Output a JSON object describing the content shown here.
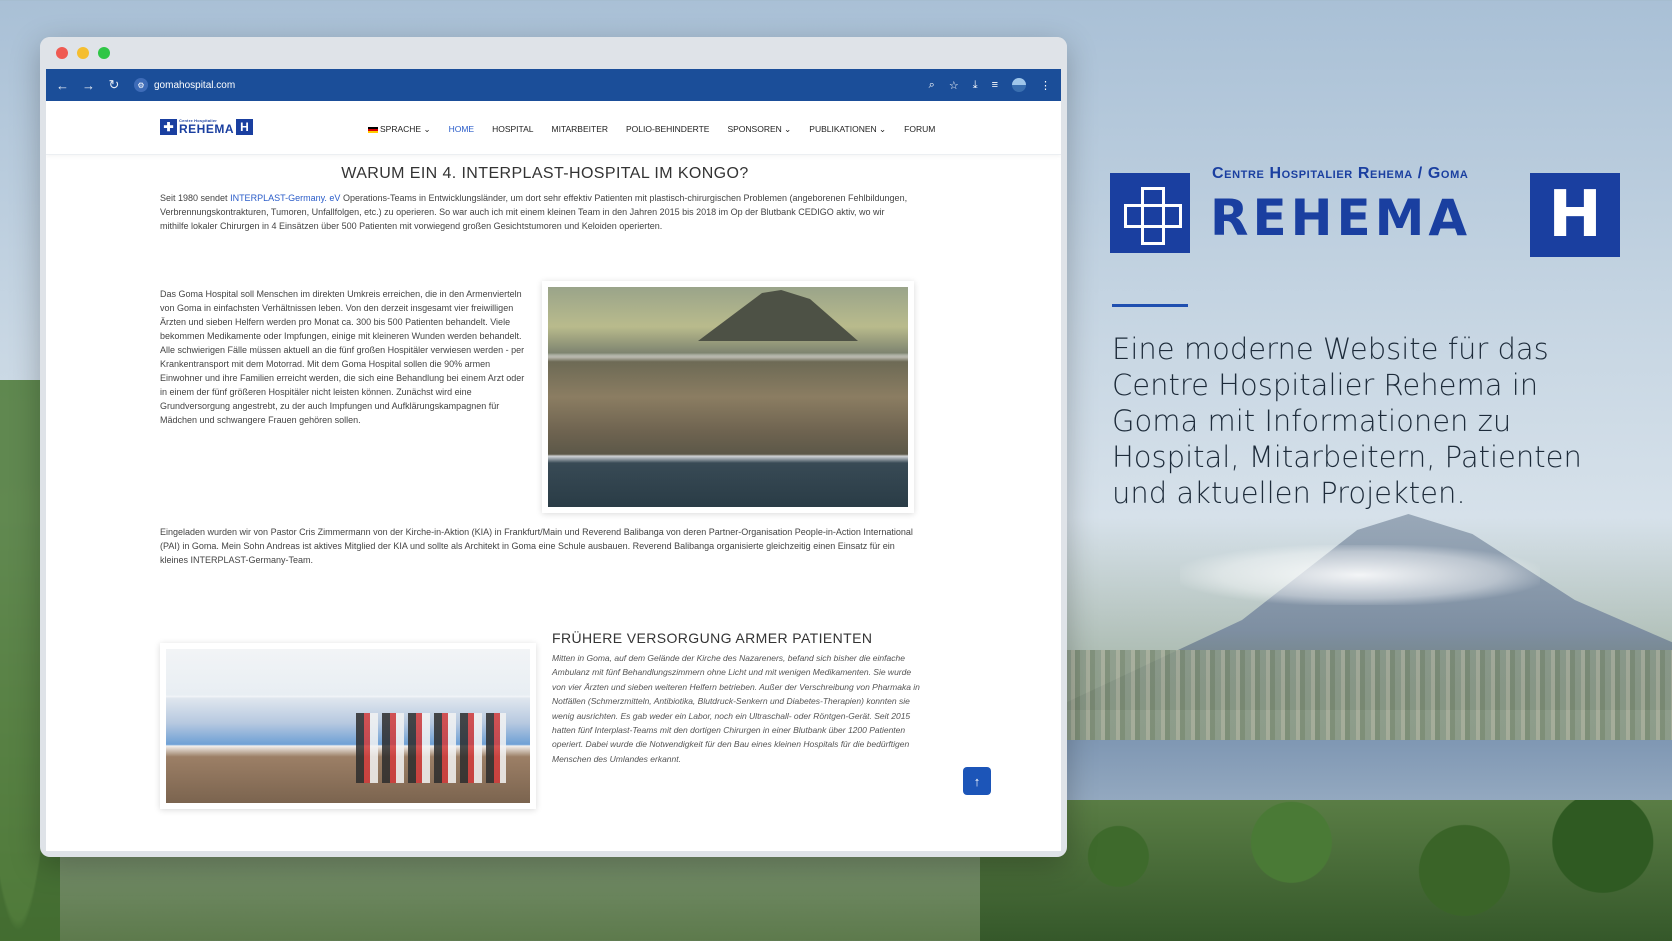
{
  "browser": {
    "url": "gomahospital.com"
  },
  "site": {
    "logo": {
      "line1": "Centre Hospitalier",
      "line2": "REHEMA",
      "h": "H"
    },
    "nav": {
      "language": "SPRACHE",
      "items": [
        "HOME",
        "HOSPITAL",
        "MITARBEITER",
        "POLIO-BEHINDERTE",
        "SPONSOREN",
        "PUBLIKATIONEN",
        "FORUM"
      ]
    }
  },
  "content": {
    "heading1": "WARUM EIN 4. INTERPLAST-HOSPITAL IM KONGO?",
    "p1_prefix": "Seit 1980 sendet ",
    "p1_link": "INTERPLAST-Germany. eV",
    "p1_suffix": " Operations-Teams in Entwicklungsländer, um dort sehr effektiv Patienten mit plastisch-chirurgischen Problemen (angeborenen Fehlbildungen, Verbrennungskontrakturen, Tumoren, Unfallfolgen, etc.) zu operieren. So war auch ich mit einem kleinen Team in den Jahren 2015 bis 2018 im Op der Blutbank CEDIGO aktiv, wo wir mithilfe lokaler Chirurgen in 4 Einsätzen über 500 Patienten mit vorwiegend großen Gesichtstumoren und Keloiden operierten.",
    "p2": "Das Goma Hospital soll Menschen im direkten Umkreis erreichen, die in den Armenvierteln von Goma in einfachsten Verhältnissen leben. Von den derzeit insgesamt vier freiwilligen Ärzten und sieben Helfern werden pro Monat ca. 300 bis 500 Patienten behandelt. Viele bekommen Medikamente oder Impfungen, einige mit kleineren Wunden werden behandelt. Alle schwierigen Fälle müssen aktuell an die fünf großen Hospitäler verwiesen werden - per Krankentransport mit dem Motorrad. Mit dem Goma Hospital sollen die 90% armen Einwohner und ihre Familien erreicht werden, die sich eine Behandlung bei einem Arzt oder in einem der fünf größeren Hospitäler nicht leisten können. Zunächst wird eine Grundversorgung angestrebt, zu der auch Impfungen und Aufklärungskampagnen für Mädchen und schwangere Frauen gehören sollen.",
    "p3": "Eingeladen wurden wir von Pastor Cris Zimmermann von der Kirche-in-Aktion (KIA) in Frankfurt/Main und Reverend Balibanga von deren Partner-Organisation People-in-Action International (PAI) in Goma. Mein Sohn Andreas ist aktives Mitglied der KIA und sollte als Architekt in Goma eine Schule ausbauen. Reverend Balibanga organisierte gleichzeitig einen Einsatz für ein kleines INTERPLAST-Germany-Team.",
    "heading2": "FRÜHERE VERSORGUNG ARMER PATIENTEN",
    "p4": "Mitten in Goma, auf dem Gelände der Kirche des Nazareners, befand sich bisher die einfache Ambulanz mit fünf Behandlungszimmern ohne Licht und mit wenigen Medikamenten. Sie wurde von vier Ärzten und sieben weiteren Helfern betrieben. Außer der Verschreibung von Pharmaka in Notfällen (Schmerzmitteln, Antibiotika, Blutdruck-Senkern und Diabetes-Therapien) konnten sie wenig ausrichten. Es gab weder ein Labor, noch ein Ultraschall- oder Röntgen-Gerät. Seit 2015 hatten fünf Interplast-Teams mit den dortigen Chirurgen in einer Blutbank über 1200 Patienten operiert. Dabei wurde die Notwendigkeit für den Bau eines kleinen Hospitals für die bedürftigen Menschen des Umlandes erkannt."
  },
  "brand": {
    "subtitle": "Centre Hospitalier Rehema / Goma",
    "name": "REHEMA",
    "h": "H",
    "tagline": "Eine moderne Website für das Centre Hospitalier Rehema in Goma mit Informationen zu Hospital, Mitarbeitern, Patienten und aktuellen Projekten.",
    "color": "#1a3fa0"
  }
}
